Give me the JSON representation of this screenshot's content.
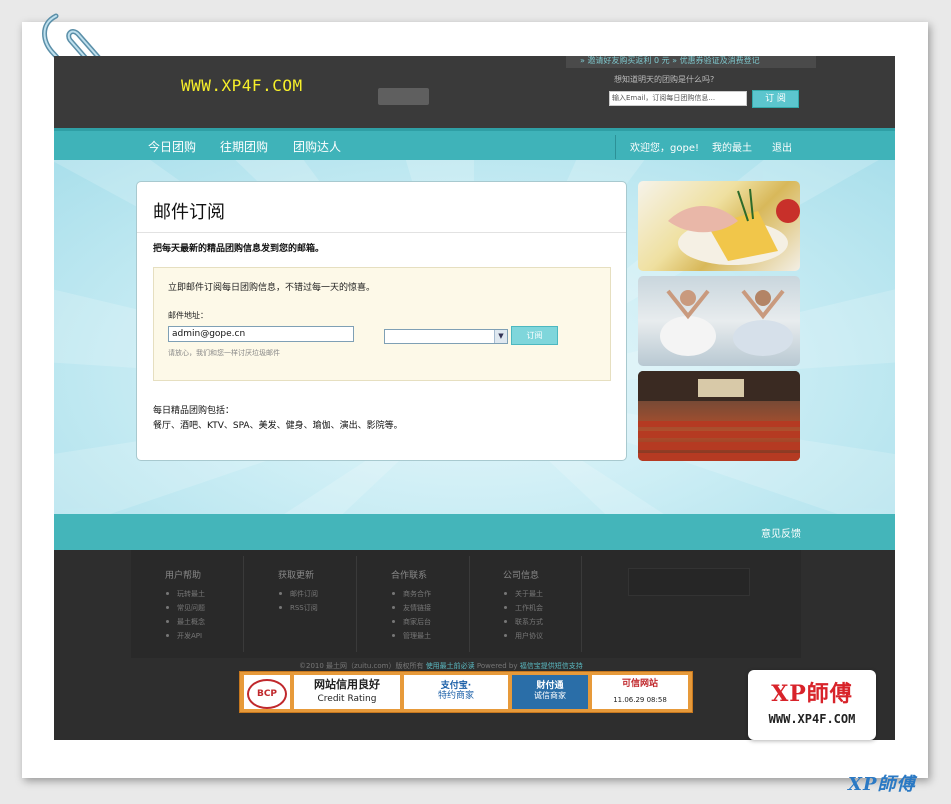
{
  "header": {
    "logo": "WWW.XP4F.COM",
    "top_strip": "» 邀请好友购买返利 0 元   » 优惠券验证及消费登记",
    "subscribe_question": "想知道明天的团购是什么吗?",
    "email_placeholder": "输入Email，订阅每日团购信息...",
    "subscribe_button": "订 阅"
  },
  "nav": {
    "items": [
      "今日团购",
      "往期团购",
      "团购达人"
    ],
    "welcome": "欢迎您，gope!",
    "my_account": "我的最土",
    "logout": "退出"
  },
  "card": {
    "title": "邮件订阅",
    "subtitle": "把每天最新的精品团购信息发到您的邮箱。",
    "intro": "立即邮件订阅每日团购信息，不错过每一天的惊喜。",
    "email_label": "邮件地址：",
    "email_value": "admin@gope.cn",
    "note": "请放心，我们和您一样讨厌垃圾邮件",
    "subscribe_button": "订阅",
    "daily_title": "每日精品团购包括：",
    "daily_list": "餐厅、酒吧、KTV、SPA、美发、健身、瑜伽、演出、影院等。"
  },
  "footer": {
    "feedback": "意见反馈",
    "columns": [
      {
        "title": "用户帮助",
        "items": [
          "玩转最土",
          "常见问题",
          "最土概念",
          "开发API"
        ]
      },
      {
        "title": "获取更新",
        "items": [
          "邮件订阅",
          "RSS订阅"
        ]
      },
      {
        "title": "合作联系",
        "items": [
          "商务合作",
          "友情链接",
          "商家后台",
          "管理最土"
        ]
      },
      {
        "title": "公司信息",
        "items": [
          "关于最土",
          "工作机会",
          "联系方式",
          "用户协议"
        ]
      }
    ],
    "copyright_a": "©2010 最土网（zuitu.com）版权所有 ",
    "copyright_link": "使用最土前必读",
    "copyright_b": "  Powered by ",
    "copyright_link2": "福信宝提供短信支持",
    "badges": [
      {
        "line1": "BCP",
        "line2": ""
      },
      {
        "line1": "网站信用良好",
        "line2": "Credit Rating"
      },
      {
        "line1": "支付宝·",
        "line2": "特约商家"
      },
      {
        "line1": "财付通",
        "line2": "诚信商家"
      },
      {
        "line1": "可信网站",
        "line2": "11.06.29 08:58"
      }
    ]
  },
  "watermark": {
    "name": "XP師傅",
    "url": "WWW.XP4F.COM",
    "corner": "XP師傅"
  }
}
